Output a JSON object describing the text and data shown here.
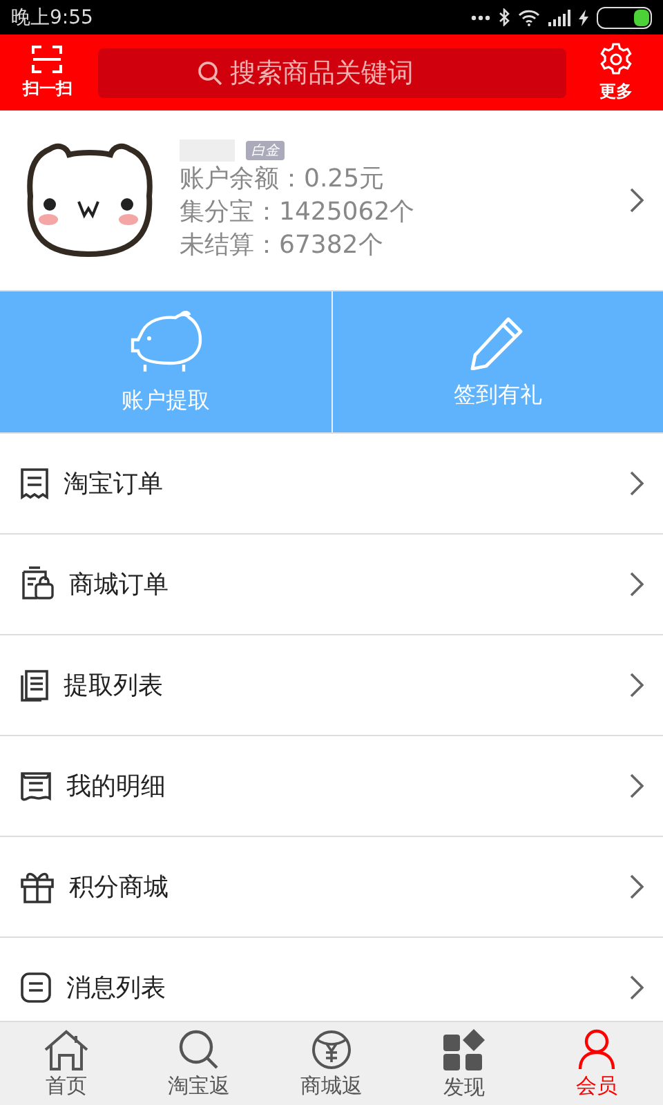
{
  "status_bar": {
    "time": "晚上9:55"
  },
  "header": {
    "scan_label": "扫一扫",
    "search": {
      "placeholder": "搜索商品关键词"
    },
    "more_label": "更多"
  },
  "profile": {
    "level_badge": "白金",
    "lines": [
      "账户余额：0.25元",
      "集分宝：1425062个",
      "未结算：67382个"
    ]
  },
  "actions": [
    {
      "kind": "piggy",
      "label": "账户提取"
    },
    {
      "kind": "pencil",
      "label": "签到有礼"
    }
  ],
  "menu": [
    {
      "kind": "receipt",
      "label": "淘宝订单"
    },
    {
      "kind": "shop",
      "label": "商城订单"
    },
    {
      "kind": "list",
      "label": "提取列表"
    },
    {
      "kind": "scroll",
      "label": "我的明细"
    },
    {
      "kind": "gift",
      "label": "积分商城"
    },
    {
      "kind": "message",
      "label": "消息列表"
    }
  ],
  "tab_bar": [
    {
      "kind": "home",
      "label": "首页",
      "selected": false
    },
    {
      "kind": "search",
      "label": "淘宝返",
      "selected": false
    },
    {
      "kind": "coin",
      "label": "商城返",
      "selected": false
    },
    {
      "kind": "grid",
      "label": "发现",
      "selected": false
    },
    {
      "kind": "person",
      "label": "会员",
      "selected": true
    }
  ]
}
